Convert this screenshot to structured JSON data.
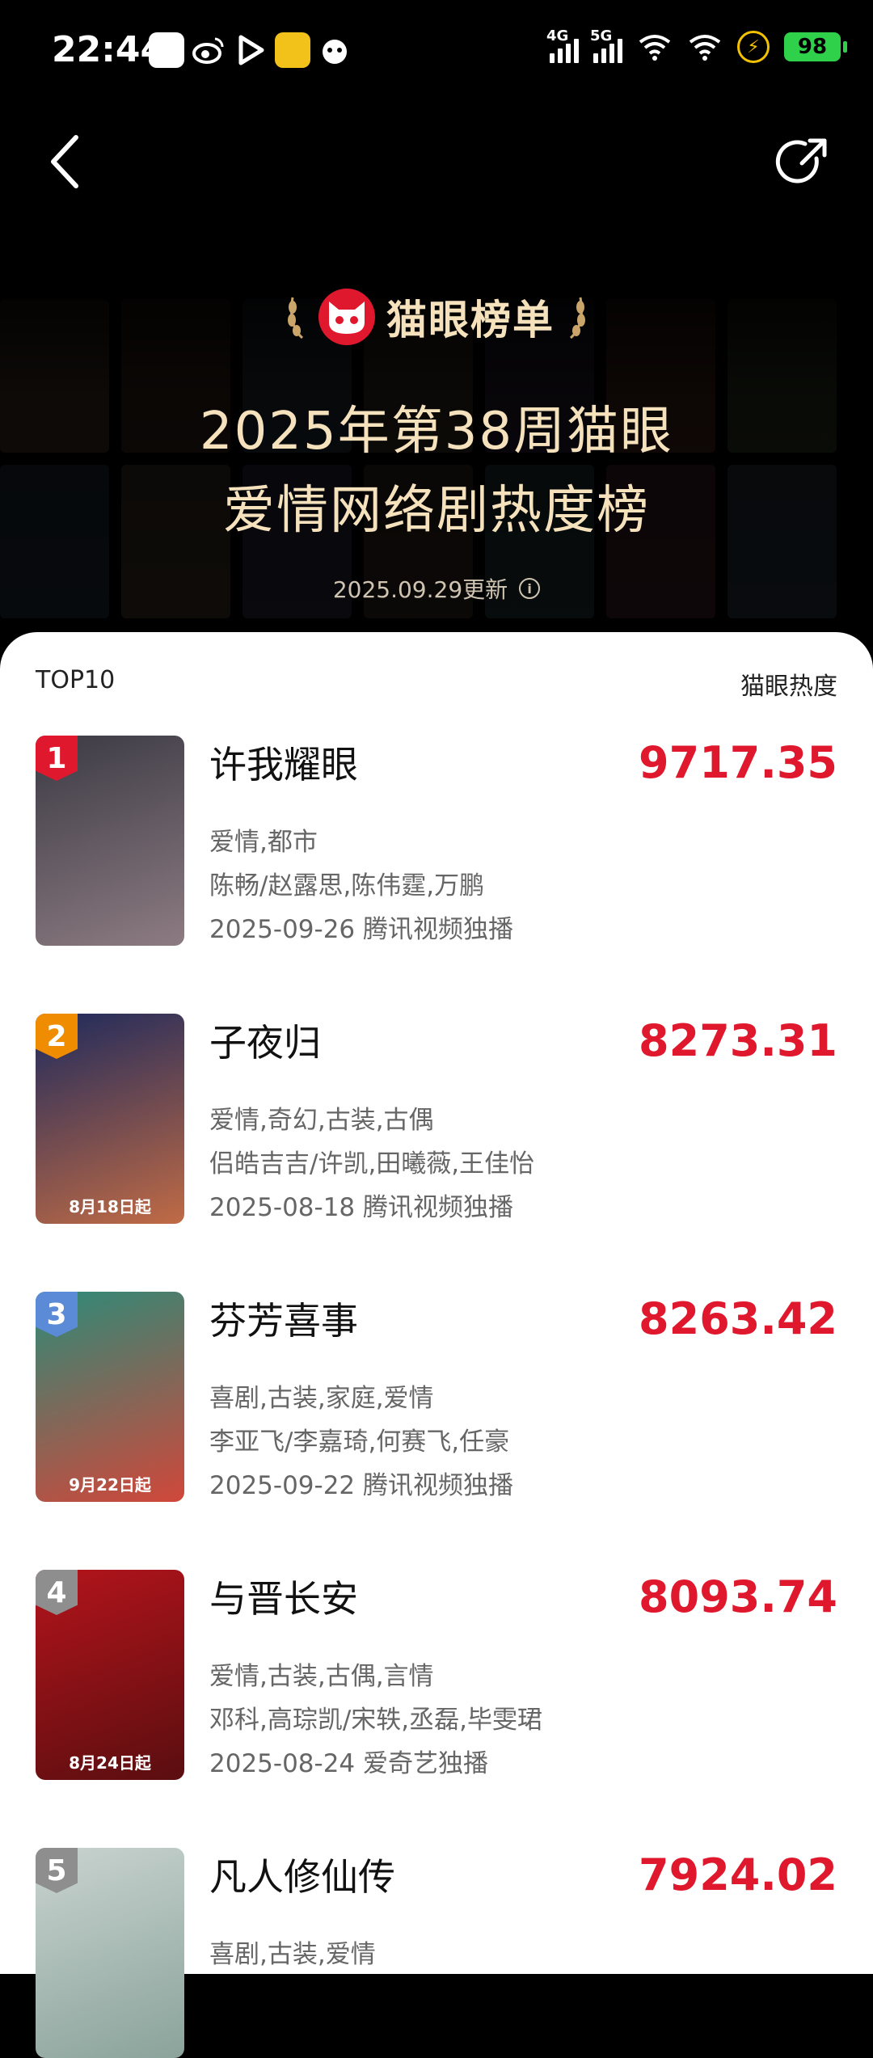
{
  "status_bar": {
    "time": "22:44",
    "net1": "4G",
    "net2": "5G",
    "battery": "98"
  },
  "header": {
    "brand": "猫眼榜单",
    "title_line1": "2025年第38周猫眼",
    "title_line2": "爱情网络剧热度榜",
    "updated": "2025.09.29更新"
  },
  "list": {
    "left_label": "TOP10",
    "right_label": "猫眼热度",
    "items": [
      {
        "rank": "1",
        "title": "许我耀眼",
        "score": "9717.35",
        "genres": "爱情,都市",
        "cast": "陈畅/赵露思,陈伟霆,万鹏",
        "release": "2025-09-26 腾讯视频独播",
        "poster_caption": "",
        "rank_color": "#e0182d",
        "poster_colors": [
          "#3b3a44",
          "#8d7b82"
        ]
      },
      {
        "rank": "2",
        "title": "子夜归",
        "score": "8273.31",
        "genres": "爱情,奇幻,古装,古偶",
        "cast": "侣皓吉吉/许凯,田曦薇,王佳怡",
        "release": "2025-08-18 腾讯视频独播",
        "poster_caption": "8月18日起",
        "rank_color": "#f08c00",
        "poster_colors": [
          "#1f2a5c",
          "#c06b45"
        ]
      },
      {
        "rank": "3",
        "title": "芬芳喜事",
        "score": "8263.42",
        "genres": "喜剧,古装,家庭,爱情",
        "cast": "李亚飞/李嘉琦,何赛飞,任豪",
        "release": "2025-09-22 腾讯视频独播",
        "poster_caption": "9月22日起",
        "rank_color": "#5b8bd6",
        "poster_colors": [
          "#2e8a78",
          "#d0473a"
        ]
      },
      {
        "rank": "4",
        "title": "与晋长安",
        "score": "8093.74",
        "genres": "爱情,古装,古偶,言情",
        "cast": "邓科,高琮凯/宋轶,丞磊,毕雯珺",
        "release": "2025-08-24 爱奇艺独播",
        "poster_caption": "8月24日起",
        "rank_color": "#8e8e8e",
        "poster_colors": [
          "#b3141b",
          "#5a0e10"
        ]
      },
      {
        "rank": "5",
        "title": "凡人修仙传",
        "score": "7924.02",
        "genres": "喜剧,古装,爱情",
        "cast": "",
        "release": "",
        "poster_caption": "",
        "rank_color": "#8e8e8e",
        "poster_colors": [
          "#c9d3cf",
          "#8aa39b"
        ]
      }
    ]
  }
}
